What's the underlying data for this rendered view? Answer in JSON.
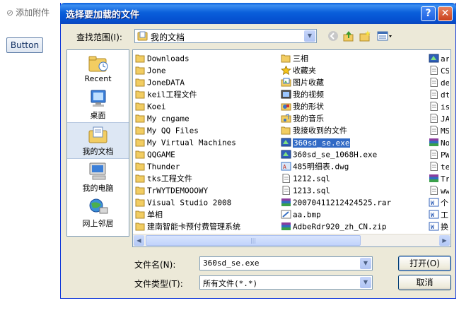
{
  "page": {
    "add_attachment": "添加附件",
    "button_label": "Button"
  },
  "dialog": {
    "title": "选择要加载的文件",
    "help_glyph": "?",
    "close_glyph": "✕",
    "look_in_label": "查找范围(I):",
    "look_in_value": "我的文档",
    "file_name_label": "文件名(N):",
    "file_name_value": "360sd_se.exe",
    "file_type_label": "文件类型(T):",
    "file_type_value": "所有文件(*.*)",
    "open_label": "打开(O)",
    "cancel_label": "取消"
  },
  "places": [
    {
      "label": "Recent",
      "icon": "recent-icon"
    },
    {
      "label": "桌面",
      "icon": "desktop-icon"
    },
    {
      "label": "我的文档",
      "icon": "my-documents-icon",
      "selected": true
    },
    {
      "label": "我的电脑",
      "icon": "my-computer-icon"
    },
    {
      "label": "网上邻居",
      "icon": "network-icon"
    }
  ],
  "files": {
    "col1": [
      {
        "name": "Downloads",
        "icon": "folder"
      },
      {
        "name": "Jone",
        "icon": "folder"
      },
      {
        "name": "JoneDATA",
        "icon": "folder"
      },
      {
        "name": "keil工程文件",
        "icon": "folder"
      },
      {
        "name": "Koei",
        "icon": "folder"
      },
      {
        "name": "My cngame",
        "icon": "folder"
      },
      {
        "name": "My QQ Files",
        "icon": "folder"
      },
      {
        "name": "My Virtual Machines",
        "icon": "folder"
      },
      {
        "name": "QQGAME",
        "icon": "folder"
      },
      {
        "name": "Thunder",
        "icon": "folder"
      },
      {
        "name": "tks工程文件",
        "icon": "folder"
      },
      {
        "name": "TrWYTDEMOOOWY",
        "icon": "folder"
      },
      {
        "name": "Visual Studio 2008",
        "icon": "folder"
      },
      {
        "name": "单相",
        "icon": "folder"
      },
      {
        "name": "建南智能卡预付费管理系统",
        "icon": "folder"
      }
    ],
    "col2": [
      {
        "name": "三相",
        "icon": "folder"
      },
      {
        "name": "收藏夹",
        "icon": "favorites"
      },
      {
        "name": "图片收藏",
        "icon": "pictures"
      },
      {
        "name": "我的视频",
        "icon": "video"
      },
      {
        "name": "我的形状",
        "icon": "shapes"
      },
      {
        "name": "我的音乐",
        "icon": "music"
      },
      {
        "name": "我接收到的文件",
        "icon": "folder"
      },
      {
        "name": "360sd_se.exe",
        "icon": "exe",
        "selected": true
      },
      {
        "name": "360sd_se_1068H.exe",
        "icon": "exe"
      },
      {
        "name": "485明细表.dwg",
        "icon": "dwg"
      },
      {
        "name": "1212.sql",
        "icon": "doc"
      },
      {
        "name": "1213.sql",
        "icon": "doc"
      },
      {
        "name": "20070411212424525.rar",
        "icon": "rar"
      },
      {
        "name": "aa.bmp",
        "icon": "bmp"
      },
      {
        "name": "AdbeRdr920_zh_CN.zip",
        "icon": "rar"
      }
    ],
    "col3": [
      {
        "name": "ar",
        "icon": "exe"
      },
      {
        "name": "CS",
        "icon": "doc"
      },
      {
        "name": "de",
        "icon": "doc"
      },
      {
        "name": "dt",
        "icon": "doc"
      },
      {
        "name": "is",
        "icon": "doc"
      },
      {
        "name": "JA",
        "icon": "doc"
      },
      {
        "name": "MS",
        "icon": "doc"
      },
      {
        "name": "No",
        "icon": "rar"
      },
      {
        "name": "PW",
        "icon": "doc"
      },
      {
        "name": "te",
        "icon": "doc"
      },
      {
        "name": "Tr",
        "icon": "rar"
      },
      {
        "name": "ww",
        "icon": "doc"
      },
      {
        "name": "个",
        "icon": "word"
      },
      {
        "name": "工",
        "icon": "word"
      },
      {
        "name": "换",
        "icon": "word"
      }
    ]
  },
  "colors": {
    "title_blue": "#0a5fdb",
    "selection": "#316ac5",
    "folder": "#f2cd62",
    "dialog_bg": "#ece9d8"
  }
}
